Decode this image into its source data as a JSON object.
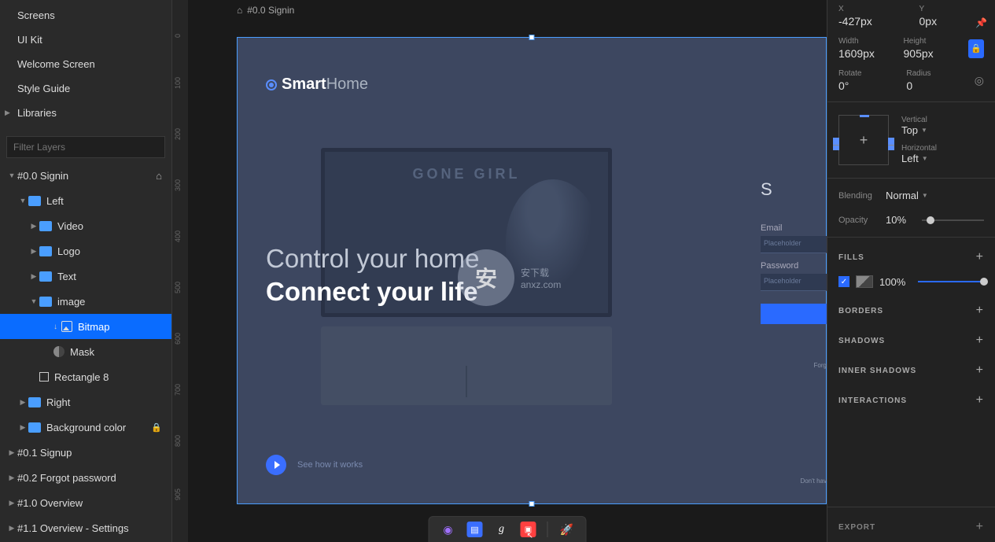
{
  "nav": {
    "screens": "Screens",
    "uikit": "UI Kit",
    "welcome": "Welcome Screen",
    "styleguide": "Style Guide",
    "libraries": "Libraries"
  },
  "filter": {
    "placeholder": "Filter Layers"
  },
  "layers": {
    "signin": "#0.0 Signin",
    "left": "Left",
    "video": "Video",
    "logo": "Logo",
    "text": "Text",
    "image": "image",
    "bitmap": "Bitmap",
    "mask": "Mask",
    "rect8": "Rectangle 8",
    "right": "Right",
    "bgcolor": "Background color",
    "signup": "#0.1 Signup",
    "forgot": "#0.2 Forgot password",
    "overview": "#1.0 Overview",
    "overviewset": "#1.1 Overview - Settings"
  },
  "ruler": {
    "v0": "0",
    "v100": "100",
    "v200": "200",
    "v300": "300",
    "v400": "400",
    "v500": "500",
    "v600": "600",
    "v700": "700",
    "v800": "800",
    "v905": "905"
  },
  "breadcrumb": {
    "page": "#0.0 Signin"
  },
  "artboard": {
    "logo_bold": "Smart",
    "logo_light": "Home",
    "gonegirl": "GONE GIRL",
    "headline1": "Control your home",
    "headline2": "Connect your life",
    "playlabel": "See how it works",
    "signin_s": "S",
    "email": "Email",
    "password": "Password",
    "placeholder": "Placeholder",
    "forgot": "Forg",
    "noacct": "Don't hav"
  },
  "watermark": {
    "brand": "安下载",
    "url": "anxz.com"
  },
  "inspector": {
    "x_label": "X",
    "x_val": "-427px",
    "y_label": "Y",
    "y_val": "0px",
    "w_label": "Width",
    "w_val": "1609px",
    "h_label": "Height",
    "h_val": "905px",
    "rot_label": "Rotate",
    "rot_val": "0°",
    "rad_label": "Radius",
    "rad_val": "0",
    "vert_label": "Vertical",
    "vert_val": "Top",
    "horiz_label": "Horizontal",
    "horiz_val": "Left",
    "blend_label": "Blending",
    "blend_val": "Normal",
    "opac_label": "Opacity",
    "opac_val": "10%",
    "fills": "FILLS",
    "fill_val": "100%",
    "borders": "BORDERS",
    "shadows": "SHADOWS",
    "ishadows": "INNER SHADOWS",
    "interactions": "INTERACTIONS",
    "export": "EXPORT"
  }
}
